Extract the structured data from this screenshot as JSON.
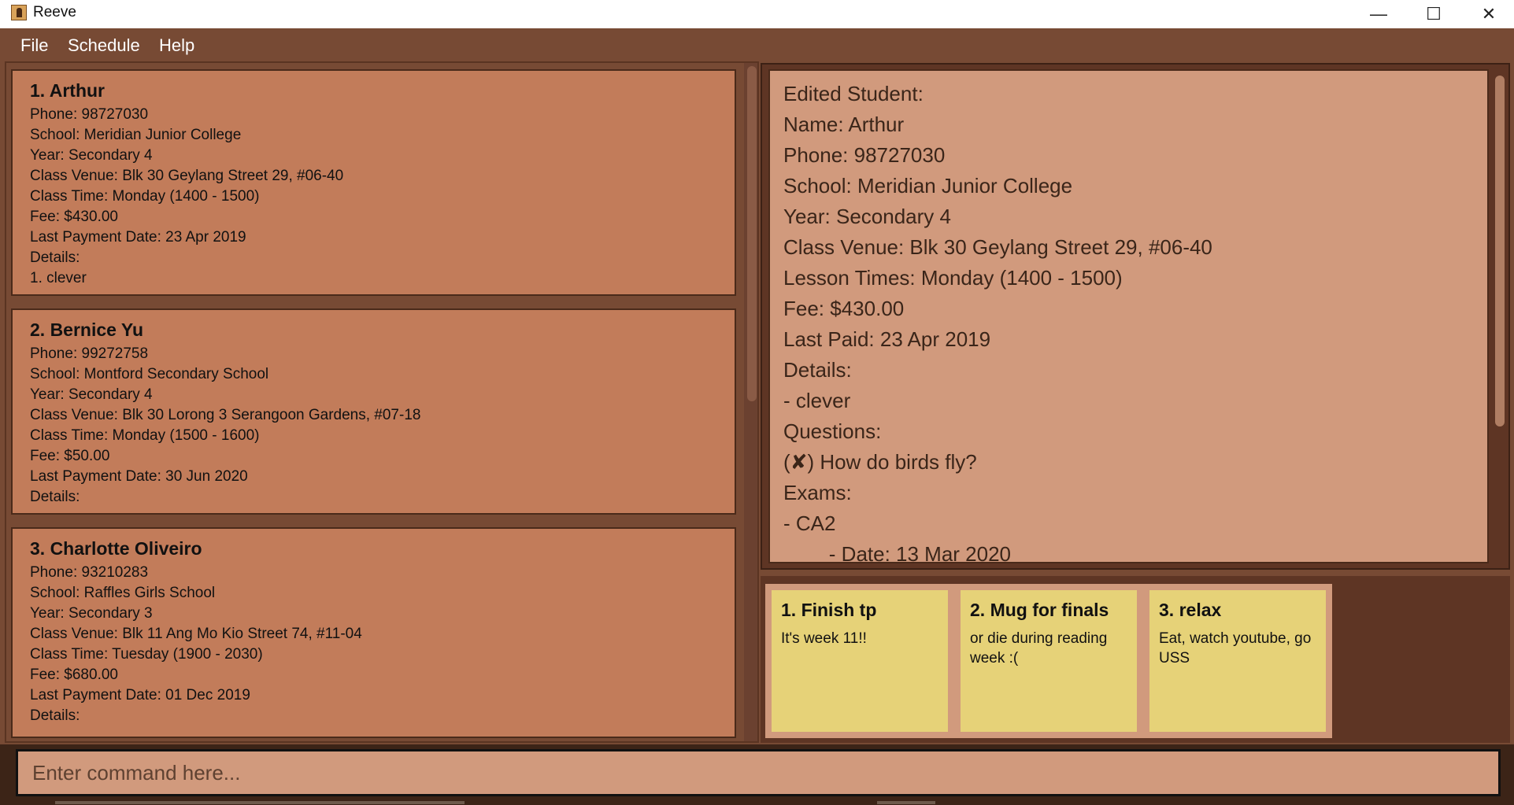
{
  "window": {
    "title": "Reeve",
    "minimize_glyph": "—",
    "maximize_glyph": "☐",
    "close_glyph": "✕"
  },
  "menu": {
    "items": [
      {
        "label": "File"
      },
      {
        "label": "Schedule"
      },
      {
        "label": "Help"
      }
    ]
  },
  "students": [
    {
      "name": "1.  Arthur",
      "lines": [
        "Phone: 98727030",
        "School: Meridian Junior College",
        "Year: Secondary 4",
        "Class Venue: Blk 30 Geylang Street 29, #06-40",
        "Class Time: Monday (1400 - 1500)",
        "Fee: $430.00",
        "Last Payment Date: 23 Apr 2019",
        "Details:",
        "1. clever"
      ]
    },
    {
      "name": "2.  Bernice Yu",
      "lines": [
        "Phone: 99272758",
        "School: Montford Secondary School",
        "Year: Secondary 4",
        "Class Venue: Blk 30 Lorong 3 Serangoon Gardens, #07-18",
        "Class Time: Monday (1500 - 1600)",
        "Fee: $50.00",
        "Last Payment Date: 30 Jun 2020",
        "Details:"
      ]
    },
    {
      "name": "3.  Charlotte Oliveiro",
      "lines": [
        "Phone: 93210283",
        "School: Raffles Girls School",
        "Year: Secondary 3",
        "Class Venue: Blk 11 Ang Mo Kio Street 74, #11-04",
        "Class Time: Tuesday (1900 - 2030)",
        "Fee: $680.00",
        "Last Payment Date: 01 Dec 2019",
        "Details:"
      ]
    }
  ],
  "detail": {
    "lines": [
      "Edited Student:",
      "Name: Arthur",
      "Phone: 98727030",
      "School: Meridian Junior College",
      "Year: Secondary 4",
      "Class Venue: Blk 30 Geylang Street 29, #06-40",
      "Lesson Times: Monday (1400 - 1500)",
      "Fee: $430.00",
      "Last Paid: 23 Apr 2019",
      "Details:",
      "- clever",
      "Questions:",
      "(✘) How do birds fly?",
      "Exams:",
      "-  CA2",
      "        - Date: 13 Mar 2020"
    ]
  },
  "notes": [
    {
      "title": "1. Finish tp",
      "description": "It's week 11!!"
    },
    {
      "title": "2. Mug for finals",
      "description": "or die during reading week :("
    },
    {
      "title": "3. relax",
      "description": "Eat, watch youtube, go USS"
    }
  ],
  "command": {
    "placeholder": "Enter command here..."
  }
}
